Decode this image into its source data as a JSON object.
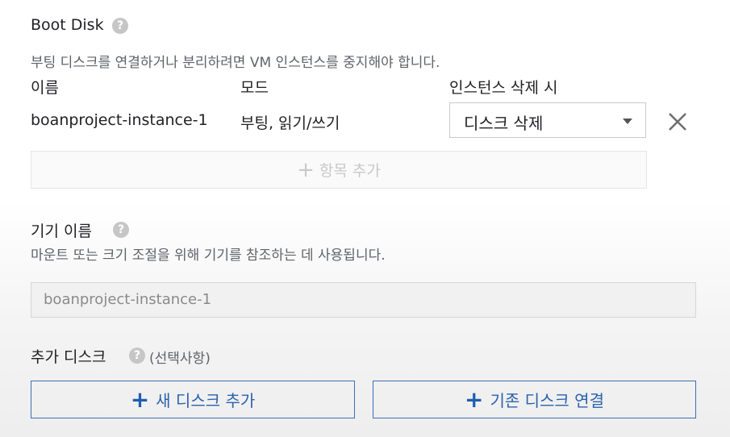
{
  "boot_disk": {
    "title": "Boot Disk",
    "help_icon": "?",
    "description": "부팅 디스크를 연결하거나 분리하려면 VM 인스턴스를 중지해야 합니다.",
    "columns": {
      "name": "이름",
      "mode": "모드",
      "on_delete": "인스턴스 삭제 시"
    },
    "row": {
      "name": "boanproject-instance-1",
      "mode": "부팅, 읽기/쓰기",
      "on_delete_value": "디스크 삭제"
    },
    "add_item": {
      "plus": "+",
      "label": "항목 추가"
    }
  },
  "device_name": {
    "title": "기기 이름",
    "help_icon": "?",
    "description": "마운트 또는 크기 조절을 위해 기기를 참조하는 데 사용됩니다.",
    "value": "boanproject-instance-1"
  },
  "additional_disks": {
    "title": "추가 디스크",
    "help_icon": "?",
    "optional": "(선택사항)",
    "add_new": {
      "plus": "+",
      "label": "새 디스크 추가"
    },
    "attach_existing": {
      "plus": "+",
      "label": "기존 디스크 연결"
    }
  },
  "colors": {
    "accent": "#2a62ad",
    "text": "#202124",
    "muted": "#5f6368"
  }
}
